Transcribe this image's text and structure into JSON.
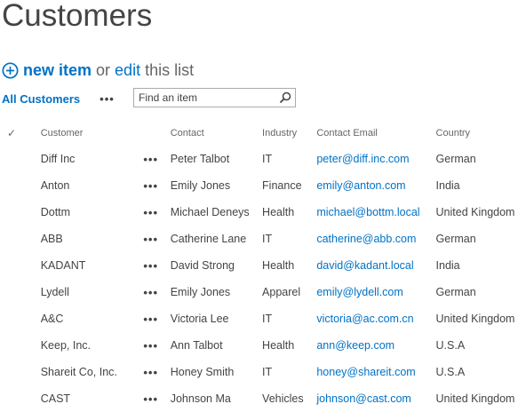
{
  "page": {
    "title": "Customers"
  },
  "actions": {
    "new_item": "new item",
    "or": "or",
    "edit": "edit",
    "this_list": "this list"
  },
  "view": {
    "name": "All Customers",
    "more": "•••"
  },
  "search": {
    "placeholder": "Find an item"
  },
  "table": {
    "headers": {
      "check": "✓",
      "customer": "Customer",
      "contact": "Contact",
      "industry": "Industry",
      "email": "Contact Email",
      "country": "Country"
    },
    "row_menu": "•••",
    "rows": [
      {
        "customer": "Diff Inc",
        "contact": "Peter Talbot",
        "industry": "IT",
        "email": "peter@diff.inc.com",
        "country": "German"
      },
      {
        "customer": "Anton",
        "contact": "Emily Jones",
        "industry": "Finance",
        "email": "emily@anton.com",
        "country": "India"
      },
      {
        "customer": "Dottm",
        "contact": "Michael Deneys",
        "industry": "Health",
        "email": "michael@bottm.local",
        "country": "United Kingdom"
      },
      {
        "customer": "ABB",
        "contact": "Catherine Lane",
        "industry": "IT",
        "email": "catherine@abb.com",
        "country": "German"
      },
      {
        "customer": "KADANT",
        "contact": "David Strong",
        "industry": "Health",
        "email": "david@kadant.local",
        "country": "India"
      },
      {
        "customer": "Lydell",
        "contact": "Emily Jones",
        "industry": "Apparel",
        "email": "emily@lydell.com",
        "country": "German"
      },
      {
        "customer": "A&C",
        "contact": "Victoria Lee",
        "industry": "IT",
        "email": "victoria@ac.com.cn",
        "country": "United Kingdom"
      },
      {
        "customer": "Keep, Inc.",
        "contact": "Ann Talbot",
        "industry": "Health",
        "email": "ann@keep.com",
        "country": "U.S.A"
      },
      {
        "customer": "Shareit Co, Inc.",
        "contact": "Honey Smith",
        "industry": "IT",
        "email": "honey@shareit.com",
        "country": "U.S.A"
      },
      {
        "customer": "CAST",
        "contact": "Johnson Ma",
        "industry": "Vehicles",
        "email": "johnson@cast.com",
        "country": "United Kingdom"
      }
    ]
  },
  "icons": {
    "new_item": "plus-circle-icon",
    "search": "search-icon"
  },
  "colors": {
    "accent": "#0072c6",
    "text": "#444444"
  }
}
